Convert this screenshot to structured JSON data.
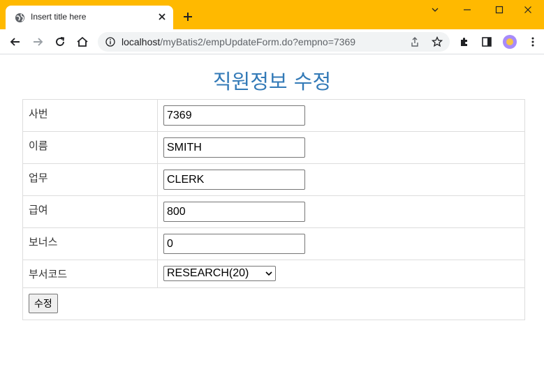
{
  "browser": {
    "tab_title": "Insert title here",
    "url_host": "localhost",
    "url_rest": "/myBatis2/empUpdateForm.do?empno=7369",
    "accent_color": "#ffb900"
  },
  "page": {
    "heading": "직원정보 수정",
    "heading_color": "#337ab7"
  },
  "form": {
    "fields": [
      {
        "label": "사번",
        "value": "7369"
      },
      {
        "label": "이름",
        "value": "SMITH"
      },
      {
        "label": "업무",
        "value": "CLERK"
      },
      {
        "label": "급여",
        "value": "800"
      },
      {
        "label": "보너스",
        "value": "0"
      }
    ],
    "dept": {
      "label": "부서코드",
      "selected": "RESEARCH(20)"
    },
    "submit_label": "수정"
  }
}
